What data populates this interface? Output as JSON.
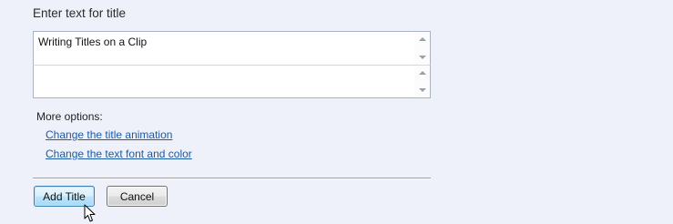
{
  "title_section": {
    "heading": "Enter text for title"
  },
  "title_input": {
    "line1": "Writing Titles on a Clip",
    "line2": ""
  },
  "more_options": {
    "label": "More options:",
    "links": [
      "Change the title animation",
      "Change the text font and color"
    ]
  },
  "actions": {
    "add_title_label": "Add Title",
    "cancel_label": "Cancel"
  },
  "icons": {
    "scroll_up": "chevron-up-icon",
    "scroll_down": "chevron-down-icon",
    "cursor": "mouse-pointer-icon"
  },
  "colors": {
    "background": "#eef1f9",
    "link": "#1c5aa6",
    "primary_button_border": "#3c7fb1"
  }
}
